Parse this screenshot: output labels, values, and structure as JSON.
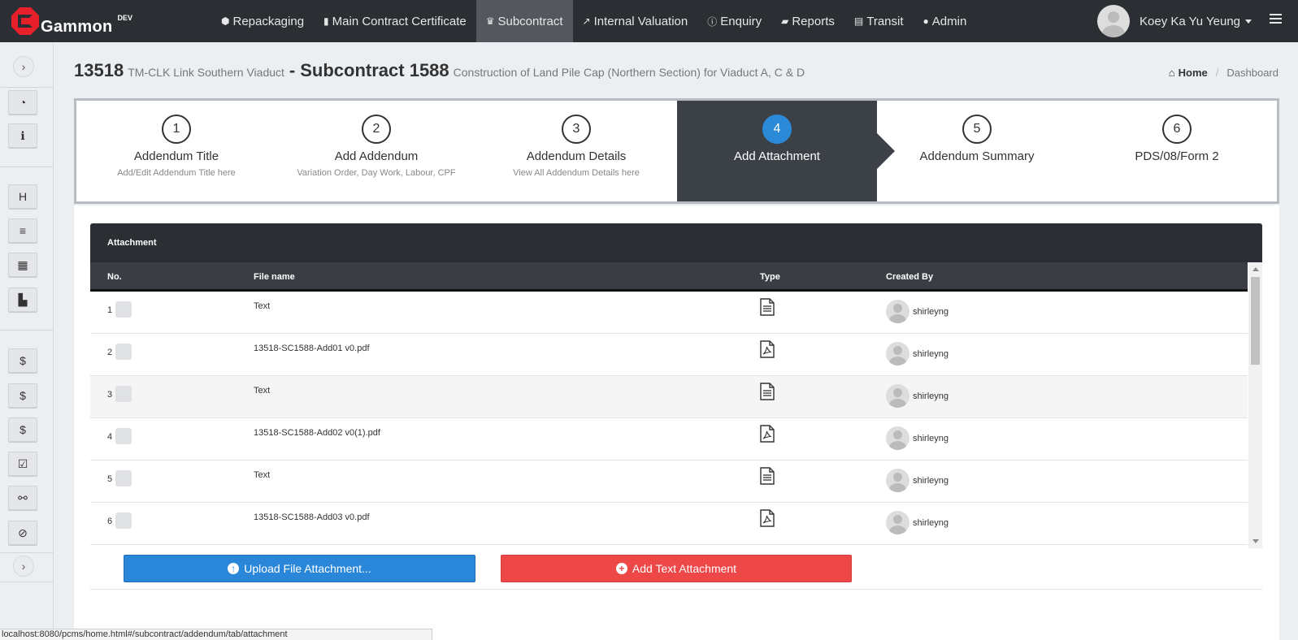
{
  "brand": {
    "name": "Gammon",
    "env": "DEV"
  },
  "nav": [
    {
      "icon": "cube-icon",
      "glyph": "⬢",
      "label": "Repackaging"
    },
    {
      "icon": "bookmark-icon",
      "glyph": "▮",
      "label": "Main Contract Certificate"
    },
    {
      "icon": "trophy-icon",
      "glyph": "♛",
      "label": "Subcontract",
      "active": true
    },
    {
      "icon": "line-chart-icon",
      "glyph": "↗",
      "label": "Internal Valuation"
    },
    {
      "icon": "info-icon",
      "glyph": "ⓘ",
      "label": "Enquiry"
    },
    {
      "icon": "book-icon",
      "glyph": "▰",
      "label": "Reports"
    },
    {
      "icon": "file-icon",
      "glyph": "▤",
      "label": "Transit"
    },
    {
      "icon": "user-icon",
      "glyph": "●",
      "label": "Admin"
    }
  ],
  "user": {
    "name": "Koey Ka Yu Yeung"
  },
  "sidebar": {
    "toggle_top": "›",
    "toggle_bottom": "›",
    "buttons": [
      {
        "name": "dashboard-icon",
        "glyph": "◔"
      },
      {
        "name": "info-icon",
        "glyph": "ℹ"
      },
      {
        "name": "header-icon",
        "glyph": "H"
      },
      {
        "name": "list-icon",
        "glyph": "≡"
      },
      {
        "name": "calendar-icon",
        "glyph": "▦"
      },
      {
        "name": "file-icon",
        "glyph": "▙"
      },
      {
        "name": "dollar-icon",
        "glyph": "$"
      },
      {
        "name": "dollar-icon",
        "glyph": "$"
      },
      {
        "name": "dollar-icon",
        "glyph": "$"
      },
      {
        "name": "check-square-icon",
        "glyph": "☑"
      },
      {
        "name": "unlink-icon",
        "glyph": "⚯"
      },
      {
        "name": "ban-icon",
        "glyph": "⊘"
      }
    ]
  },
  "header": {
    "job_no": "13518",
    "job_name": "TM-CLK Link Southern Viaduct",
    "separator": "-",
    "subcontract": "Subcontract 1588",
    "subcontract_desc": "Construction of Land Pile Cap (Northern Section) for Viaduct A, C & D"
  },
  "breadcrumb": {
    "home_icon": "⌂",
    "home": "Home",
    "current": "Dashboard"
  },
  "wizard": [
    {
      "num": "1",
      "title": "Addendum Title",
      "desc": "Add/Edit Addendum Title here"
    },
    {
      "num": "2",
      "title": "Add Addendum",
      "desc": "Variation Order, Day Work, Labour, CPF"
    },
    {
      "num": "3",
      "title": "Addendum Details",
      "desc": "View All Addendum Details here"
    },
    {
      "num": "4",
      "title": "Add Attachment",
      "desc": "",
      "active": true
    },
    {
      "num": "5",
      "title": "Addendum Summary",
      "desc": ""
    },
    {
      "num": "6",
      "title": "PDS/08/Form 2",
      "desc": ""
    }
  ],
  "attachment": {
    "title": "Attachment",
    "columns": {
      "no": "No.",
      "file": "File name",
      "type": "Type",
      "created": "Created By"
    },
    "rows": [
      {
        "no": "1",
        "file": "Text",
        "type": "text",
        "created_by": "shirleyng"
      },
      {
        "no": "2",
        "file": "13518-SC1588-Add01 v0.pdf",
        "type": "pdf",
        "created_by": "shirleyng"
      },
      {
        "no": "3",
        "file": "Text",
        "type": "text",
        "created_by": "shirleyng"
      },
      {
        "no": "4",
        "file": "13518-SC1588-Add02 v0(1).pdf",
        "type": "pdf",
        "created_by": "shirleyng"
      },
      {
        "no": "5",
        "file": "Text",
        "type": "text",
        "created_by": "shirleyng"
      },
      {
        "no": "6",
        "file": "13518-SC1588-Add03 v0.pdf",
        "type": "pdf",
        "created_by": "shirleyng"
      }
    ]
  },
  "buttons": {
    "upload": "Upload File Attachment...",
    "add_text": "Add Text Attachment"
  },
  "status_url": "localhost:8080/pcms/home.html#/subcontract/addendum/tab/attachment"
}
